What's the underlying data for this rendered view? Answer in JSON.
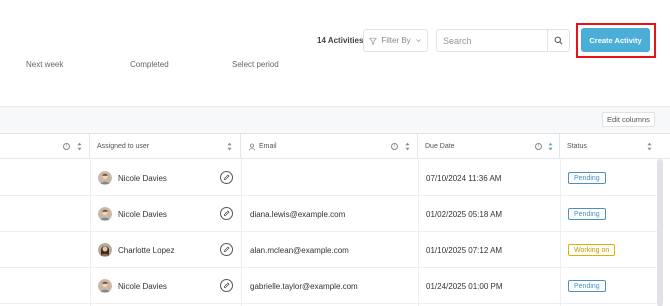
{
  "header": {
    "activity_count": "14 Activities",
    "filter_label": "Filter By",
    "search_placeholder": "Search",
    "create_button": "Create Activity"
  },
  "tabs": [
    "Next week",
    "Completed",
    "Select period"
  ],
  "edit_columns": "Edit columns",
  "columns": {
    "assigned": "Assigned to user",
    "email": "Email",
    "due_date": "Due Date",
    "status": "Status"
  },
  "rows": [
    {
      "user": "Nicole Davies",
      "email": "",
      "due": "07/10/2024 11:36 AM",
      "status": "Pending"
    },
    {
      "user": "Nicole Davies",
      "email": "diana.lewis@example.com",
      "due": "01/02/2025 05:18 AM",
      "status": "Pending"
    },
    {
      "user": "Charlotte Lopez",
      "email": "alan.mclean@example.com",
      "due": "01/10/2025 07:12 AM",
      "status": "Working on"
    },
    {
      "user": "Nicole Davies",
      "email": "gabrielle.taylor@example.com",
      "due": "01/24/2025 01:00 PM",
      "status": "Pending"
    }
  ],
  "colors": {
    "accent": "#4aaed9",
    "highlight": "#e4141b",
    "pending": "#4a90c8",
    "working": "#d9a400"
  }
}
